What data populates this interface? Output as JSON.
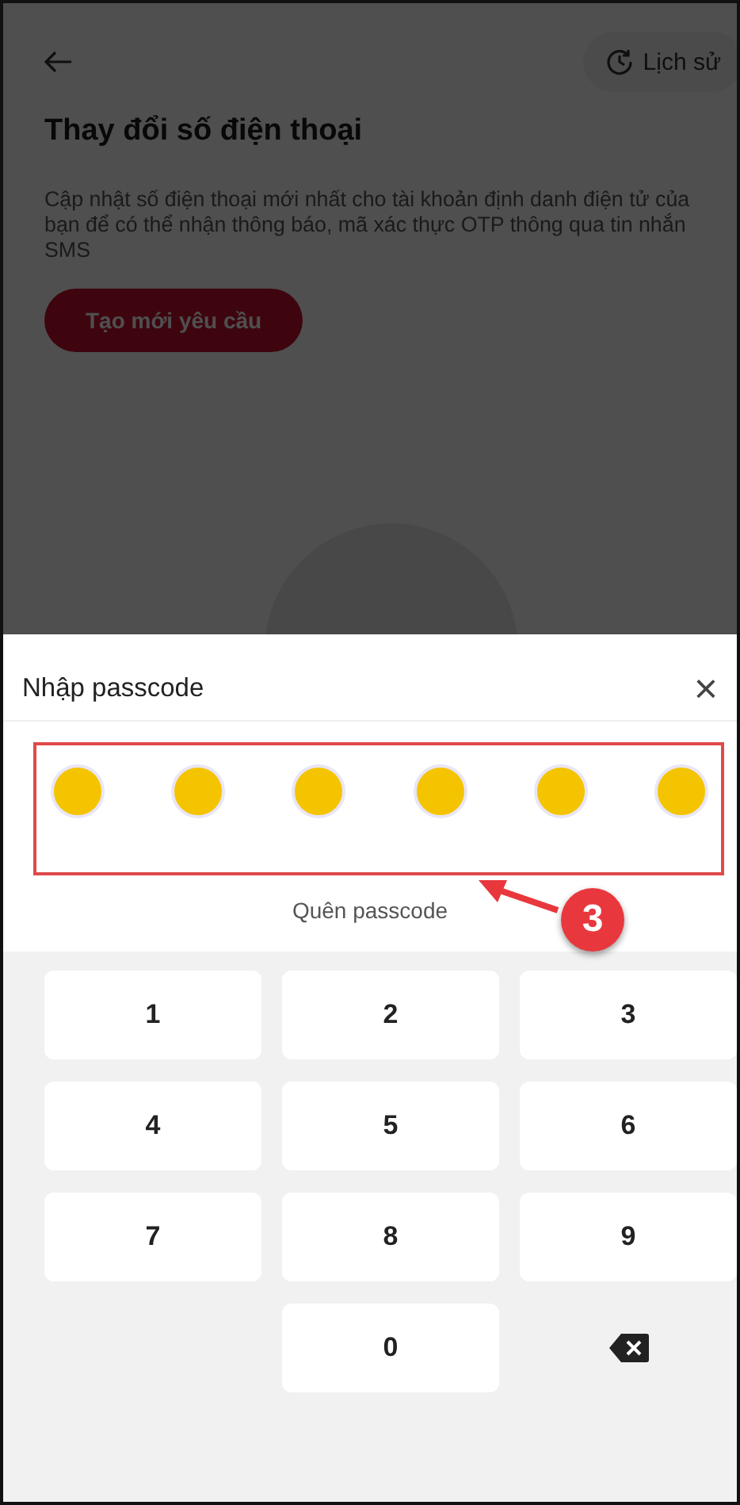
{
  "page": {
    "history_button": "Lịch sử",
    "title": "Thay đổi số điện thoại",
    "description": "Cập nhật số điện thoại mới nhất cho tài khoản định danh điện tử của bạn để có thể nhận thông báo, mã xác thực OTP thông qua tin nhắn SMS",
    "create_button": "Tạo mới yêu cầu"
  },
  "sheet": {
    "title": "Nhập passcode",
    "close": "×",
    "dots": [
      {
        "filled": true
      },
      {
        "filled": true
      },
      {
        "filled": true
      },
      {
        "filled": true
      },
      {
        "filled": true
      },
      {
        "filled": true
      }
    ],
    "forgot_link": "Quên passcode"
  },
  "keypad": [
    {
      "kind": "digit",
      "label": "1"
    },
    {
      "kind": "digit",
      "label": "2"
    },
    {
      "kind": "digit",
      "label": "3"
    },
    {
      "kind": "digit",
      "label": "4"
    },
    {
      "kind": "digit",
      "label": "5"
    },
    {
      "kind": "digit",
      "label": "6"
    },
    {
      "kind": "digit",
      "label": "7"
    },
    {
      "kind": "digit",
      "label": "8"
    },
    {
      "kind": "digit",
      "label": "9"
    },
    {
      "kind": "blank"
    },
    {
      "kind": "digit",
      "label": "0"
    },
    {
      "kind": "backspace"
    }
  ],
  "annotation": {
    "step_badge": "3"
  }
}
